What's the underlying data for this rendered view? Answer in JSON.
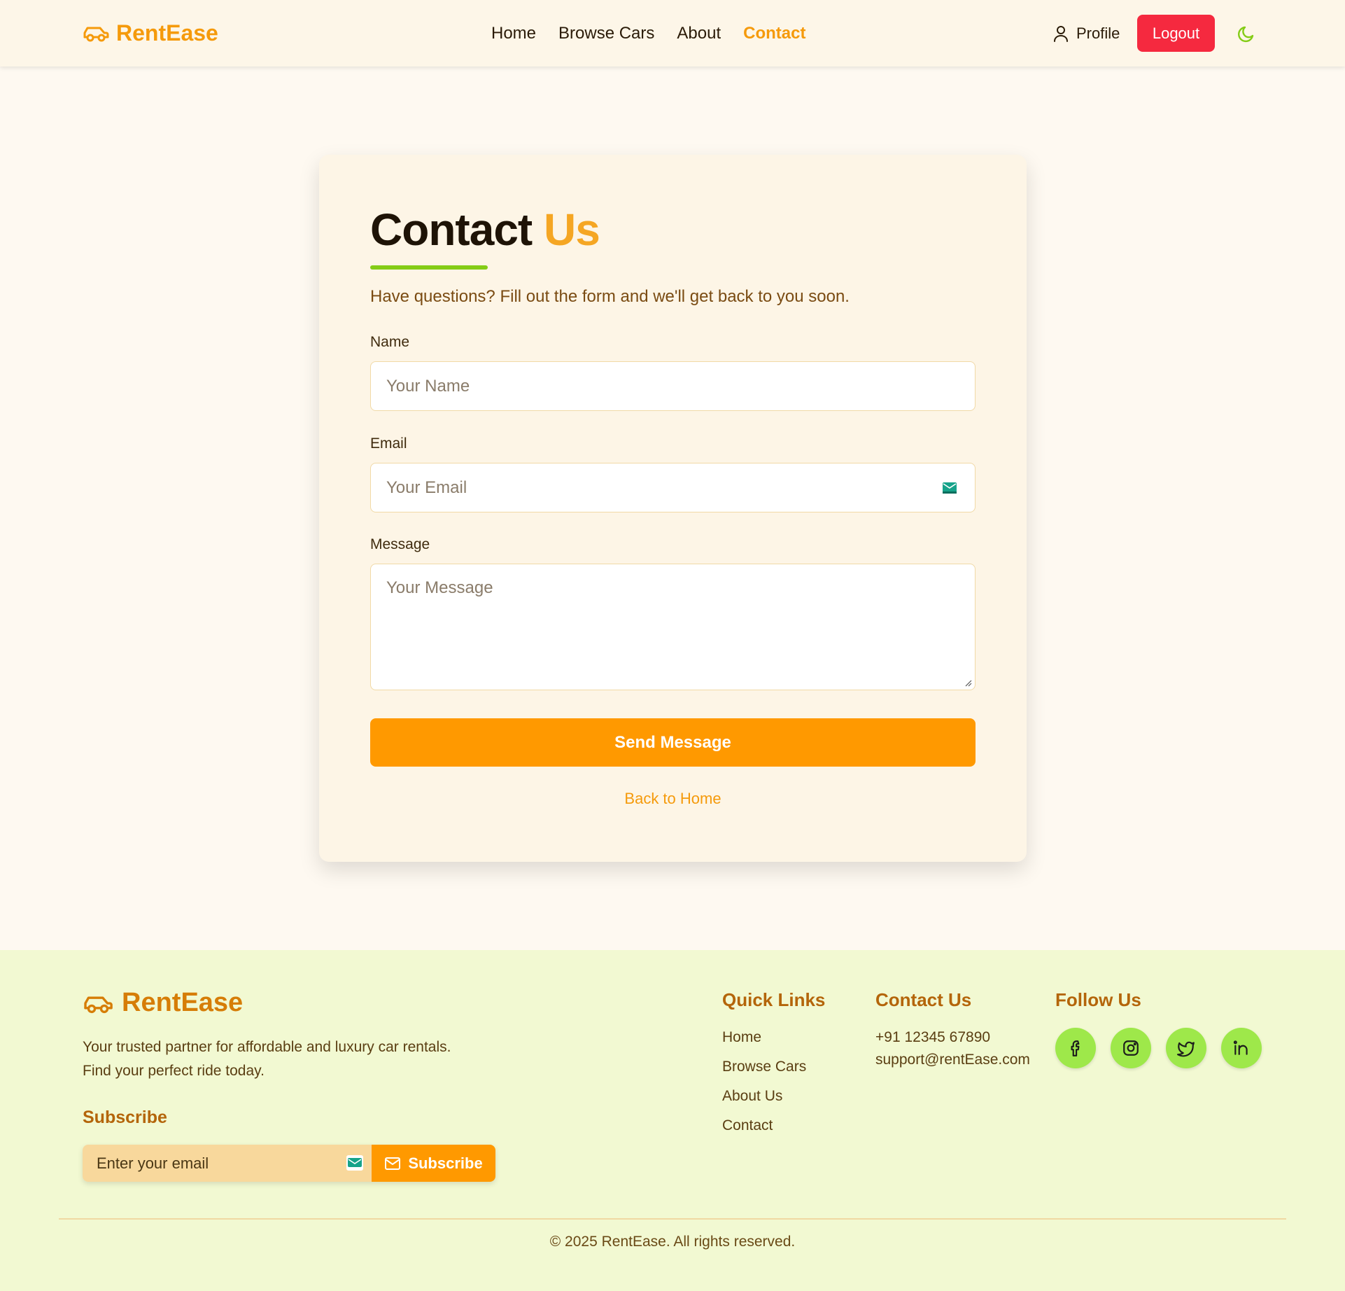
{
  "header": {
    "brand": "RentEase",
    "nav": [
      "Home",
      "Browse Cars",
      "About",
      "Contact"
    ],
    "active_nav": "Contact",
    "profile_label": "Profile",
    "logout_label": "Logout"
  },
  "contact": {
    "title_main": "Contact",
    "title_accent": "Us",
    "subtitle": "Have questions? Fill out the form and we'll get back to you soon.",
    "name_label": "Name",
    "name_placeholder": "Your Name",
    "email_label": "Email",
    "email_placeholder": "Your Email",
    "message_label": "Message",
    "message_placeholder": "Your Message",
    "send_label": "Send Message",
    "back_label": "Back to Home"
  },
  "footer": {
    "brand": "RentEase",
    "tagline_line1": "Your trusted partner for affordable and luxury car rentals.",
    "tagline_line2": "Find your perfect ride today.",
    "subscribe_heading": "Subscribe",
    "subscribe_placeholder": "Enter your email",
    "subscribe_button": "Subscribe",
    "quick_links_heading": "Quick Links",
    "quick_links": [
      "Home",
      "Browse Cars",
      "About Us",
      "Contact"
    ],
    "contact_heading": "Contact Us",
    "phone": "+91 12345 67890",
    "email": "support@rentEase.com",
    "follow_heading": "Follow Us",
    "socials": [
      "facebook-icon",
      "instagram-icon",
      "twitter-icon",
      "linkedin-icon"
    ],
    "copyright": "© 2025 RentEase. All rights reserved."
  },
  "colors": {
    "brand_orange": "#f59a0b",
    "button_orange": "#ff9900",
    "logout_red": "#f5293f",
    "accent_green": "#84cc16",
    "footer_bg": "#f2f9d2"
  }
}
